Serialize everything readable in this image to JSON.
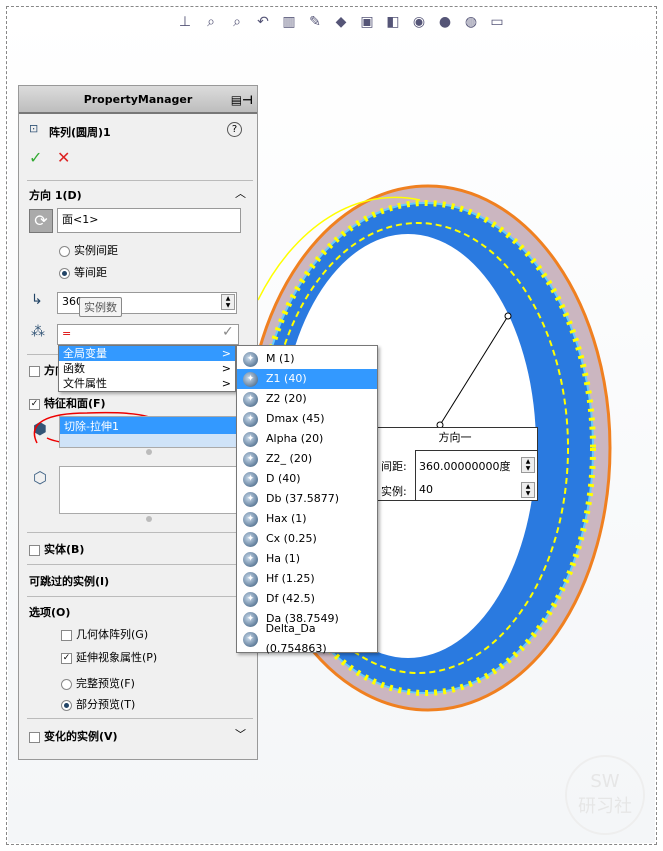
{
  "toolbar": {
    "icons": [
      "view-orientation-icon",
      "zoom-to-fit-icon",
      "zoom-area-icon",
      "previous-view-icon",
      "section-view-icon",
      "dynamic-annotation-icon",
      "view-orientation-cube-icon",
      "display-style-icon",
      "hide-show-icon",
      "edit-appearance-icon",
      "apply-scene-icon",
      "view-settings-icon"
    ]
  },
  "panel": {
    "title": "PropertyManager",
    "feature_name": "阵列(圆周)1",
    "direction1": {
      "label": "方向 1(D)",
      "axis_value": "面<1>",
      "radio1": "实例间距",
      "radio2": "等间距",
      "angle_value": "360",
      "tooltip": "实例数",
      "count_value": "="
    },
    "direction2_label": "方向 2",
    "features_label": "特征和面(F)",
    "feature_item": "切除-拉伸1",
    "bodies_label": "实体(B)",
    "skip_label": "可跳过的实例(I)",
    "options": {
      "label": "选项(O)",
      "geometry": "几何体阵列(G)",
      "visual": "延伸视象属性(P)",
      "full": "完整预览(F)",
      "partial": "部分预览(T)"
    },
    "vary_label": "变化的实例(V)"
  },
  "menu": {
    "items": [
      {
        "label": "全局变量",
        "arrow": ">"
      },
      {
        "label": "函数",
        "arrow": ">"
      },
      {
        "label": "文件属性",
        "arrow": ">"
      }
    ]
  },
  "submenu": {
    "items": [
      "M (1)",
      "Z1 (40)",
      "Z2 (20)",
      "Dmax (45)",
      "Alpha (20)",
      "Z2_ (20)",
      "D (40)",
      "Db (37.5877)",
      "Hax (1)",
      "Cx (0.25)",
      "Ha (1)",
      "Hf (1.25)",
      "Df (42.5)",
      "Da (38.7549)",
      "Delta_Da (0.754863)"
    ]
  },
  "callout": {
    "title": "方向一",
    "spacing_label": "间距:",
    "spacing_value": "360.00000000度",
    "count_label": "实例:",
    "count_value": "40"
  },
  "watermark": "SW 研习社"
}
